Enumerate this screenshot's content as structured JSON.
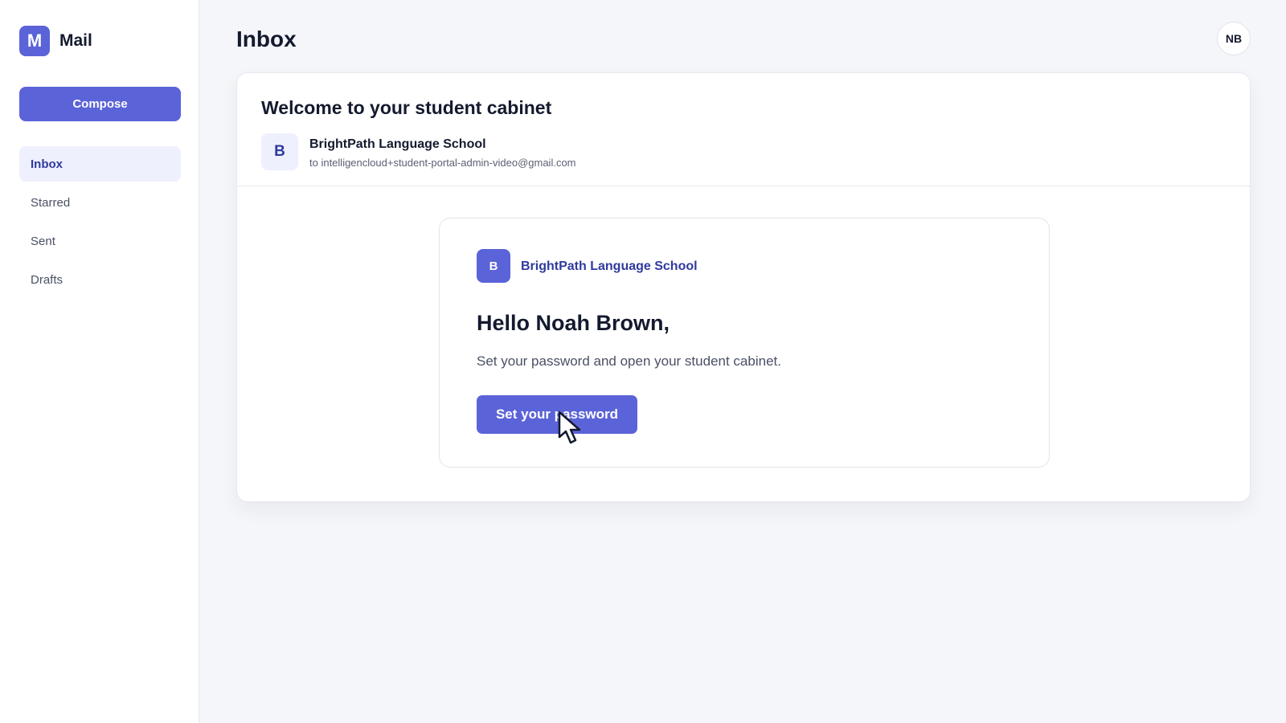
{
  "app": {
    "logo_letter": "M",
    "name": "Mail"
  },
  "sidebar": {
    "compose_label": "Compose",
    "items": [
      {
        "label": "Inbox",
        "active": true
      },
      {
        "label": "Starred",
        "active": false
      },
      {
        "label": "Sent",
        "active": false
      },
      {
        "label": "Drafts",
        "active": false
      }
    ]
  },
  "header": {
    "title": "Inbox",
    "user_initials": "NB"
  },
  "email": {
    "subject": "Welcome to your student cabinet",
    "sender_initial": "B",
    "sender_name": "BrightPath Language School",
    "recipient_line": "to intelligencloud+student-portal-admin-video@gmail.com",
    "body": {
      "logo_letter": "B",
      "school_name": "BrightPath Language School",
      "greeting": "Hello Noah Brown,",
      "text": "Set your password and open your student cabinet.",
      "cta_label": "Set your password"
    }
  },
  "colors": {
    "accent": "#5b63d8",
    "accent_text": "#2f3a9e",
    "active_bg": "#eef0fd",
    "page_bg": "#f5f6fa"
  },
  "icons": {
    "cursor": "mouse-pointer-icon"
  }
}
